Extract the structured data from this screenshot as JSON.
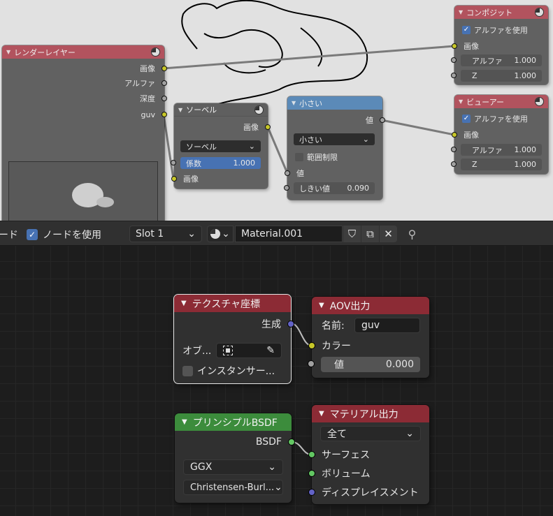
{
  "compositor": {
    "render_layers": {
      "title": "レンダーレイヤー",
      "outputs": [
        "画像",
        "アルファ",
        "深度",
        "guv"
      ]
    },
    "sobel": {
      "title": "ソーベル",
      "output": "画像",
      "dropdown": "ソーベル",
      "factor_label": "係数",
      "factor_value": "1.000",
      "input": "画像"
    },
    "smaller": {
      "title": "小さい",
      "output": "値",
      "dropdown": "小さい",
      "clamp": "範囲制限",
      "input": "値",
      "threshold_label": "しきい値",
      "threshold_value": "0.090"
    },
    "composite": {
      "title": "コンポジット",
      "use_alpha": "アルファを使用",
      "input": "画像",
      "alpha_label": "アルファ",
      "alpha_value": "1.000",
      "z_label": "Z",
      "z_value": "1.000"
    },
    "viewer": {
      "title": "ビューアー",
      "use_alpha": "アルファを使用",
      "input": "画像",
      "alpha_label": "アルファ",
      "alpha_value": "1.000",
      "z_label": "Z",
      "z_value": "1.000"
    }
  },
  "toolbar": {
    "partial_label": "ード",
    "use_nodes": "ノードを使用",
    "slot": "Slot 1",
    "material": "Material.001"
  },
  "shader": {
    "tex_coord": {
      "title": "テクスチャ座標",
      "output": "生成",
      "object_label": "オブ...",
      "instancer": "インスタンサー..."
    },
    "aov": {
      "title": "AOV出力",
      "name_label": "名前:",
      "name_value": "guv",
      "color": "カラー",
      "value_label": "値",
      "value_value": "0.000"
    },
    "bsdf": {
      "title": "プリンシプルBSDF",
      "output": "BSDF",
      "distribution": "GGX",
      "subsurface": "Christensen-Burl..."
    },
    "mat_out": {
      "title": "マテリアル出力",
      "target": "全て",
      "surface": "サーフェス",
      "volume": "ボリューム",
      "displacement": "ディスプレイスメント"
    }
  },
  "colors": {
    "compositor_bg": "#e1e1e1",
    "editor_bg": "#1d1d1d",
    "output_header": "#8c2b35",
    "shader_header": "#3c8c3c",
    "accent": "#4772b3"
  }
}
